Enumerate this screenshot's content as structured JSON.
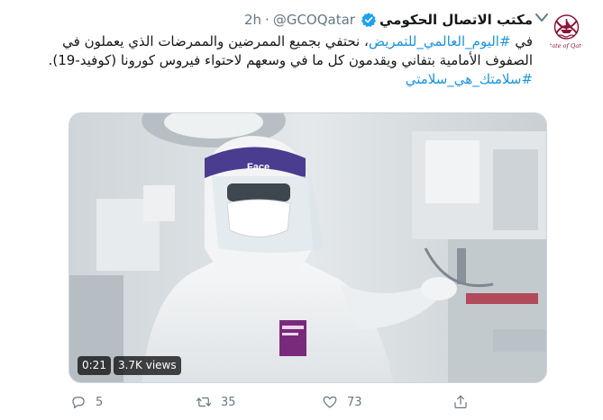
{
  "account": {
    "name": "مكتب الاتصال الحكومي",
    "handle": "@GCOQatar",
    "separator": "·",
    "time": "2h",
    "avatar_icon": "state-of-qatar-logo-icon",
    "logo_text": "State of Qatar"
  },
  "tweet": {
    "line1_prefix": "في ",
    "hashtag1": "#اليوم_العالمي_للتمريض",
    "line1_rest": "، نحتفي بجميع الممرضين والممرضات الذي يعملون في الصفوف الأمامية بتفاني ويقدمون كل ما في وسعهم لاحتواء فيروس كورونا (كوفيد-19).",
    "hashtag2": "#سلامتك_هي_سلامتي"
  },
  "media": {
    "duration": "0:21",
    "views": "3.7K views",
    "gown_label": "Face"
  },
  "actions": {
    "reply_count": "5",
    "retweet_count": "35",
    "like_count": "73",
    "reply_icon": "reply-icon",
    "retweet_icon": "retweet-icon",
    "like_icon": "heart-icon",
    "share_icon": "share-icon"
  },
  "colors": {
    "link": "#1b95e0",
    "muted": "#657786",
    "logo_maroon": "#8a1538",
    "verified": "#1da1f2"
  }
}
